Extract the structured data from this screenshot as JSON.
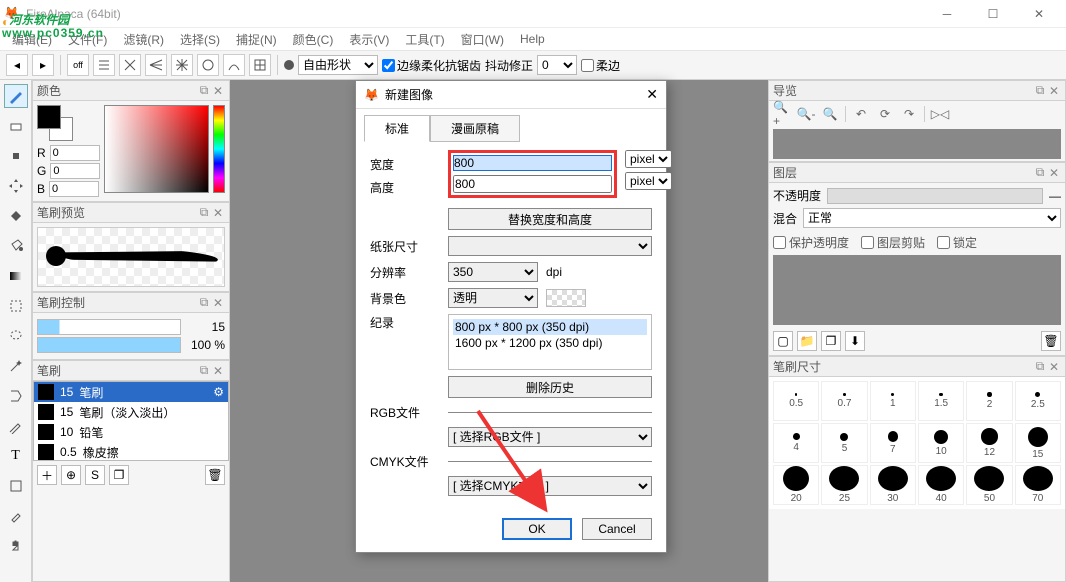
{
  "app": {
    "title": "FireAlpaca (64bit)"
  },
  "watermark": {
    "line1_a": "河东软件园",
    "line2": "www.pc0359.cn"
  },
  "menu": [
    "编辑(E)",
    "文件(F)",
    "滤镜(R)",
    "选择(S)",
    "捕捉(N)",
    "颜色(C)",
    "表示(V)",
    "工具(T)",
    "窗口(W)",
    "Help"
  ],
  "toolbar": {
    "shape_select": "自由形状",
    "antialias": "边缘柔化抗锯齿",
    "shake_correction": "抖动修正",
    "shake_value": "0",
    "soft_edge": "柔边"
  },
  "panels": {
    "color": {
      "title": "颜色",
      "r_label": "R",
      "g_label": "G",
      "b_label": "B",
      "r": "0",
      "g": "0",
      "b": "0"
    },
    "brush_preview": {
      "title": "笔刷预览"
    },
    "brush_control": {
      "title": "笔刷控制",
      "size": "15",
      "opacity": "100 %"
    },
    "brush": {
      "title": "笔刷",
      "items": [
        {
          "size": "15",
          "name": "笔刷"
        },
        {
          "size": "15",
          "name": "笔刷（淡入淡出）"
        },
        {
          "size": "10",
          "name": "铅笔"
        },
        {
          "size": "0.5",
          "name": "橡皮擦"
        }
      ]
    },
    "navigator": {
      "title": "导览"
    },
    "layer": {
      "title": "图层",
      "opacity_label": "不透明度",
      "blend_label": "混合",
      "blend_mode": "正常",
      "protect_alpha": "保护透明度",
      "clipping": "图层剪贴",
      "lock": "锁定"
    },
    "brush_size": {
      "title": "笔刷尺寸",
      "sizes": [
        "0.5",
        "0.7",
        "1",
        "1.5",
        "2",
        "2.5",
        "4",
        "5",
        "7",
        "10",
        "12",
        "15",
        "20",
        "25",
        "30",
        "40",
        "50",
        "70"
      ]
    }
  },
  "dialog": {
    "title": "新建图像",
    "tab_standard": "标准",
    "tab_comic": "漫画原稿",
    "width_label": "宽度",
    "width_value": "800",
    "width_unit": "pixel",
    "height_label": "高度",
    "height_value": "800",
    "height_unit": "pixel",
    "swap_btn": "替换宽度和高度",
    "paper_label": "纸张尺寸",
    "dpi_label": "分辨率",
    "dpi_value": "350",
    "dpi_unit": "dpi",
    "bg_label": "背景色",
    "bg_value": "透明",
    "history_label": "纪录",
    "history": [
      "800 px * 800 px (350 dpi)",
      "1600 px * 1200 px (350 dpi)"
    ],
    "delete_history": "删除历史",
    "rgb_label": "RGB文件",
    "rgb_select": "[ 选择RGB文件 ]",
    "cmyk_label": "CMYK文件",
    "cmyk_select": "[ 选择CMYK文件 ]",
    "ok": "OK",
    "cancel": "Cancel"
  }
}
